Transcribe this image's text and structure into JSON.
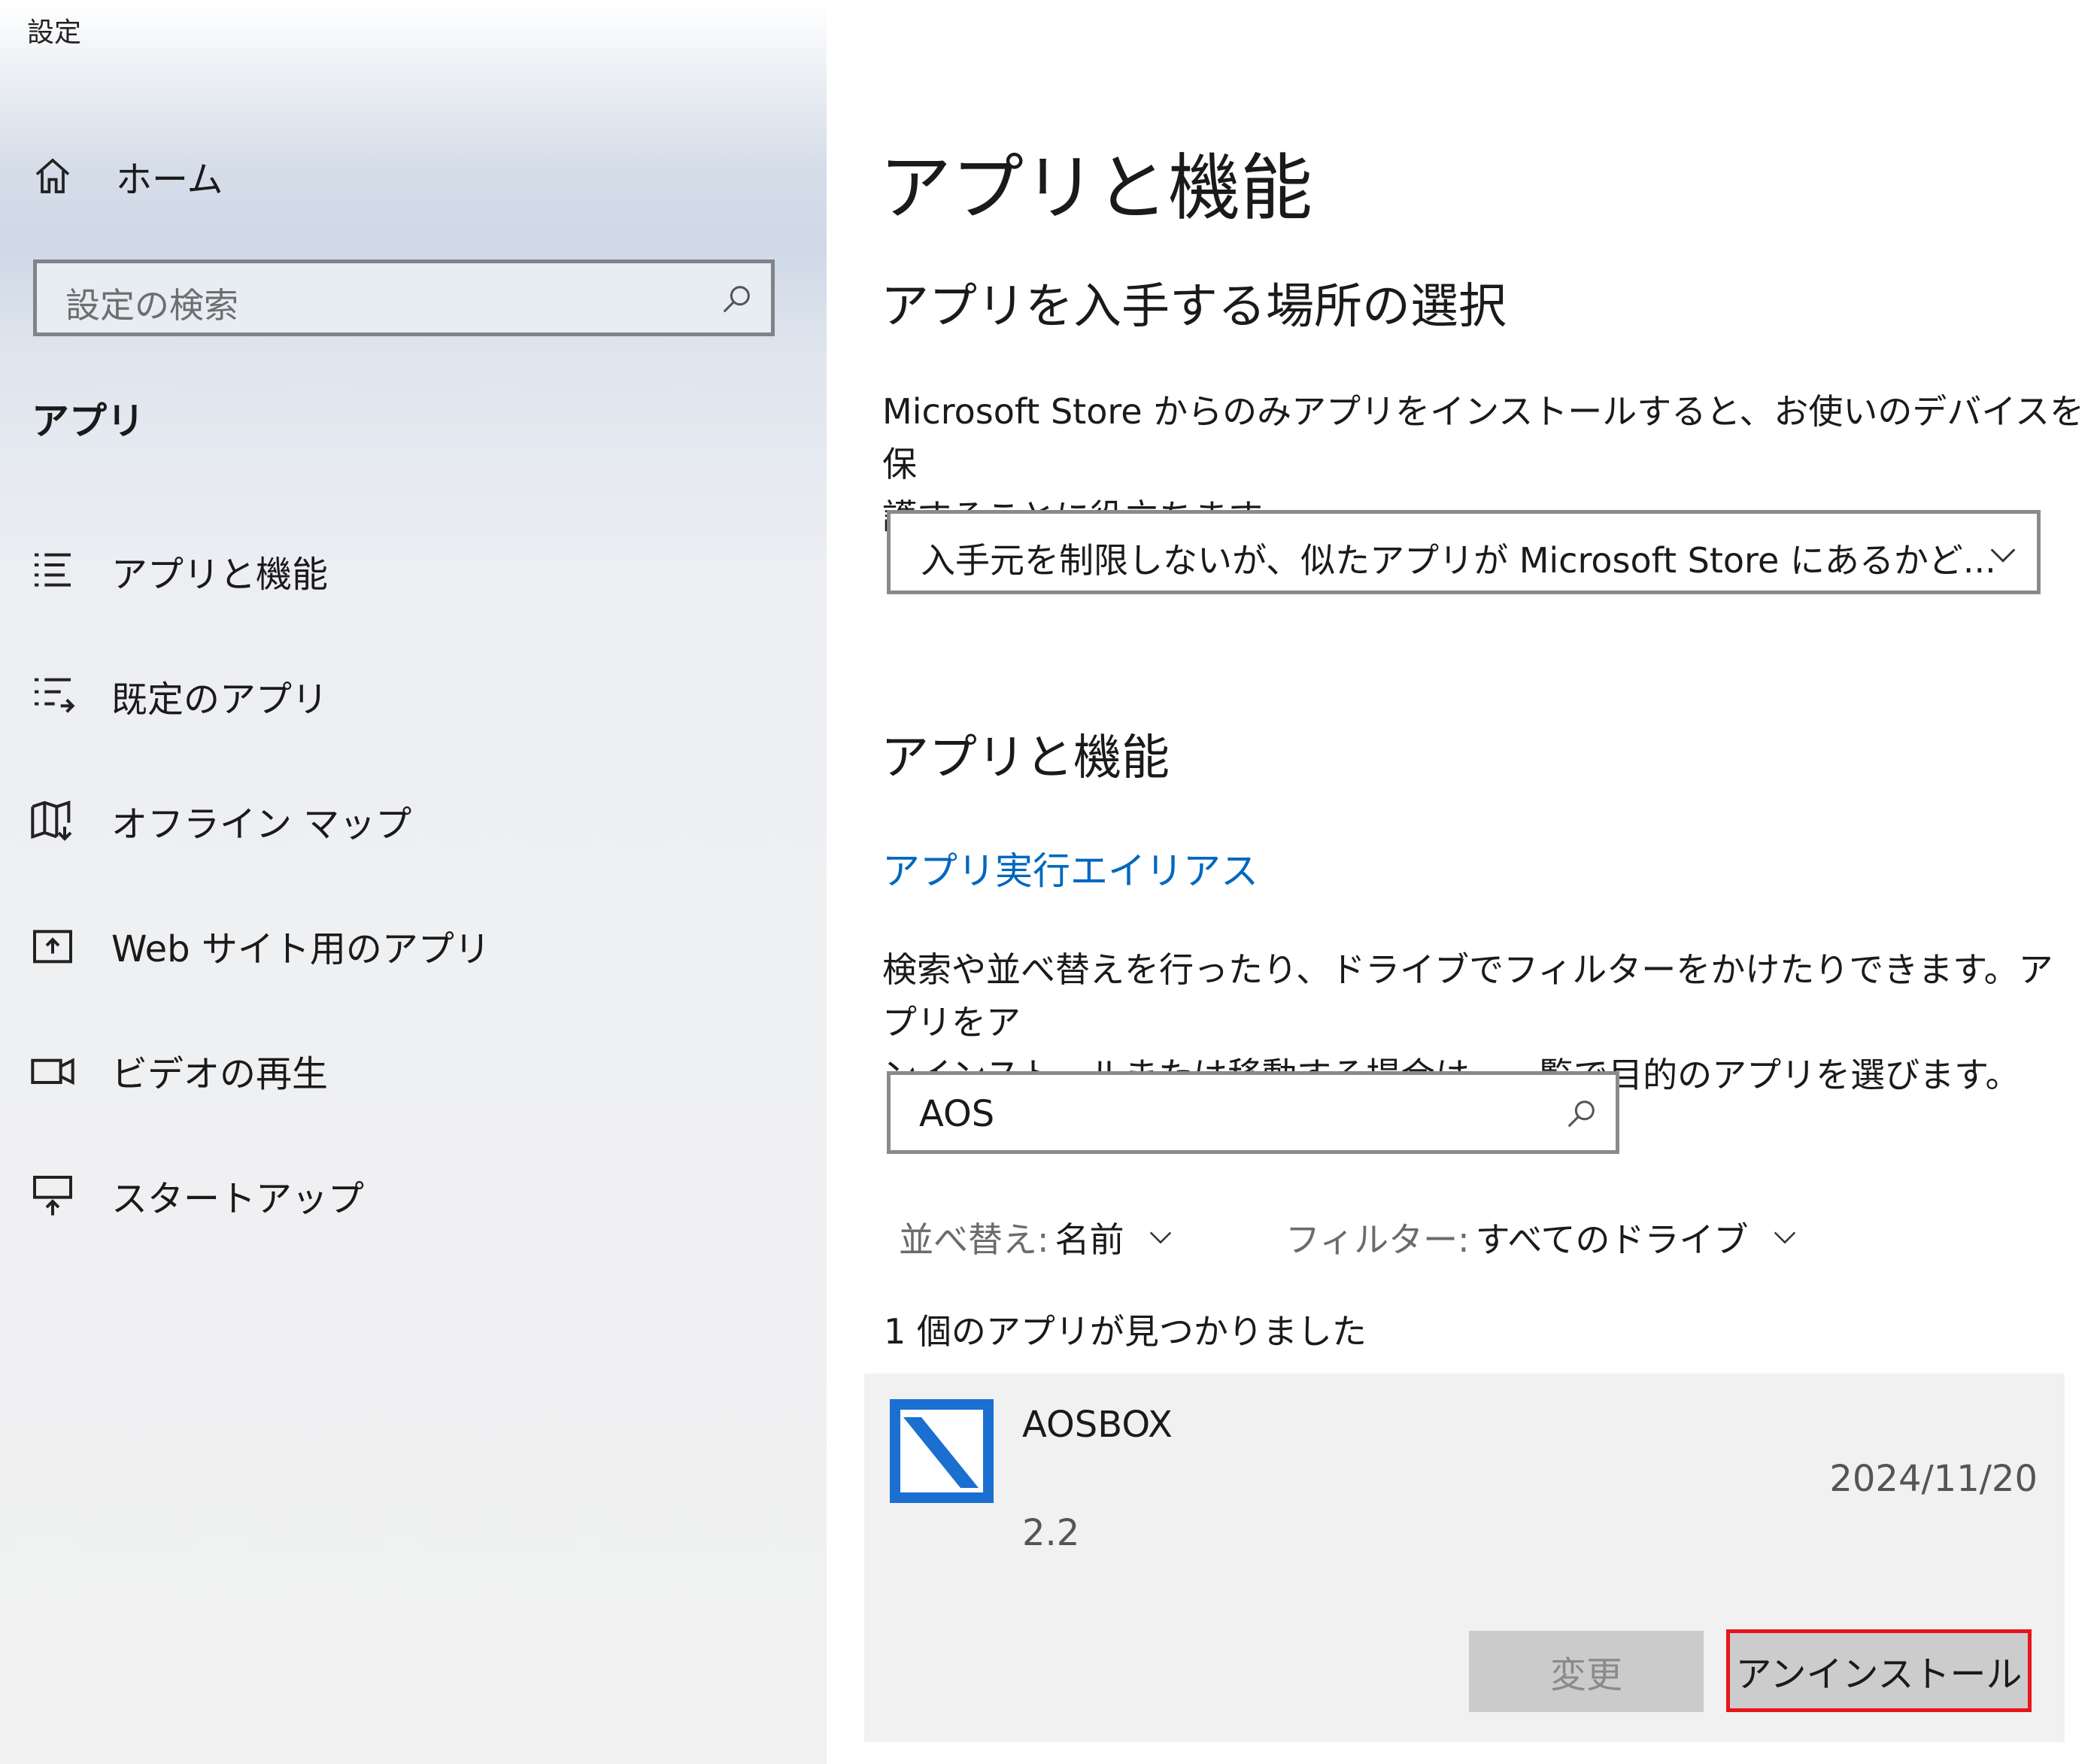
{
  "window": {
    "title": "設定"
  },
  "sidebar": {
    "home_label": "ホーム",
    "search_placeholder": "設定の検索",
    "section_title": "アプリ",
    "items": [
      {
        "label": "アプリと機能",
        "icon": "apps-features-icon"
      },
      {
        "label": "既定のアプリ",
        "icon": "default-apps-icon"
      },
      {
        "label": "オフライン マップ",
        "icon": "offline-maps-icon"
      },
      {
        "label": "Web サイト用のアプリ",
        "icon": "apps-for-websites-icon"
      },
      {
        "label": "ビデオの再生",
        "icon": "video-playback-icon"
      },
      {
        "label": "スタートアップ",
        "icon": "startup-icon"
      }
    ]
  },
  "main": {
    "page_title": "アプリと機能",
    "source_section": {
      "heading": "アプリを入手する場所の選択",
      "description_line1": "Microsoft Store からのみアプリをインストールすると、お使いのデバイスを保",
      "description_line2": "護することに役立ちます。",
      "dropdown_value": "入手元を制限しないが、似たアプリが Microsoft Store にあるかど..."
    },
    "apps_section": {
      "heading": "アプリと機能",
      "alias_link": "アプリ実行エイリアス",
      "description_line1": "検索や並べ替えを行ったり、ドライブでフィルターをかけたりできます。アプリをア",
      "description_line2": "ンインストールまたは移動する場合は、一覧で目的のアプリを選びます。",
      "search_value": "AOS",
      "sort_label": "並べ替え:",
      "sort_value": "名前",
      "filter_label": "フィルター:",
      "filter_value": "すべてのドライブ",
      "result_count": "1 個のアプリが見つかりました"
    },
    "app": {
      "name": "AOSBOX",
      "version": "2.2",
      "date": "2024/11/20",
      "modify_label": "変更",
      "uninstall_label": "アンインストール"
    }
  },
  "colors": {
    "accent_link": "#0067c0",
    "highlight_border": "#e8141b",
    "app_icon": "#1a6fd0"
  }
}
